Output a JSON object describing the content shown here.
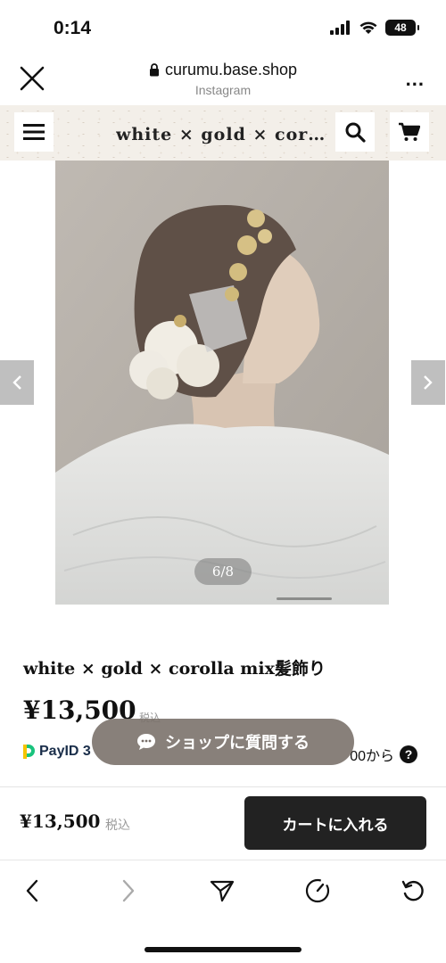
{
  "status": {
    "time": "0:14",
    "battery": "48"
  },
  "browser": {
    "url": "curumu.base.shop",
    "source": "Instagram",
    "more": "..."
  },
  "shop": {
    "title": "white × gold × corolla mix髪飾り"
  },
  "gallery": {
    "counter": "6/8"
  },
  "product": {
    "name": "white × gold × corolla mix髪飾り",
    "price": "¥13,500",
    "tax": "税込",
    "payid_label": "PayID 3",
    "payid_tail": "00から"
  },
  "ask_button": {
    "label": "ショップに質問する"
  },
  "buy_bar": {
    "price": "¥13,500",
    "tax": "税込",
    "cart_label": "カートに入れる"
  },
  "colors": {
    "shop_header_bg": "#f3efe9",
    "cart_button": "#222222",
    "ask_button": "#786e68"
  }
}
